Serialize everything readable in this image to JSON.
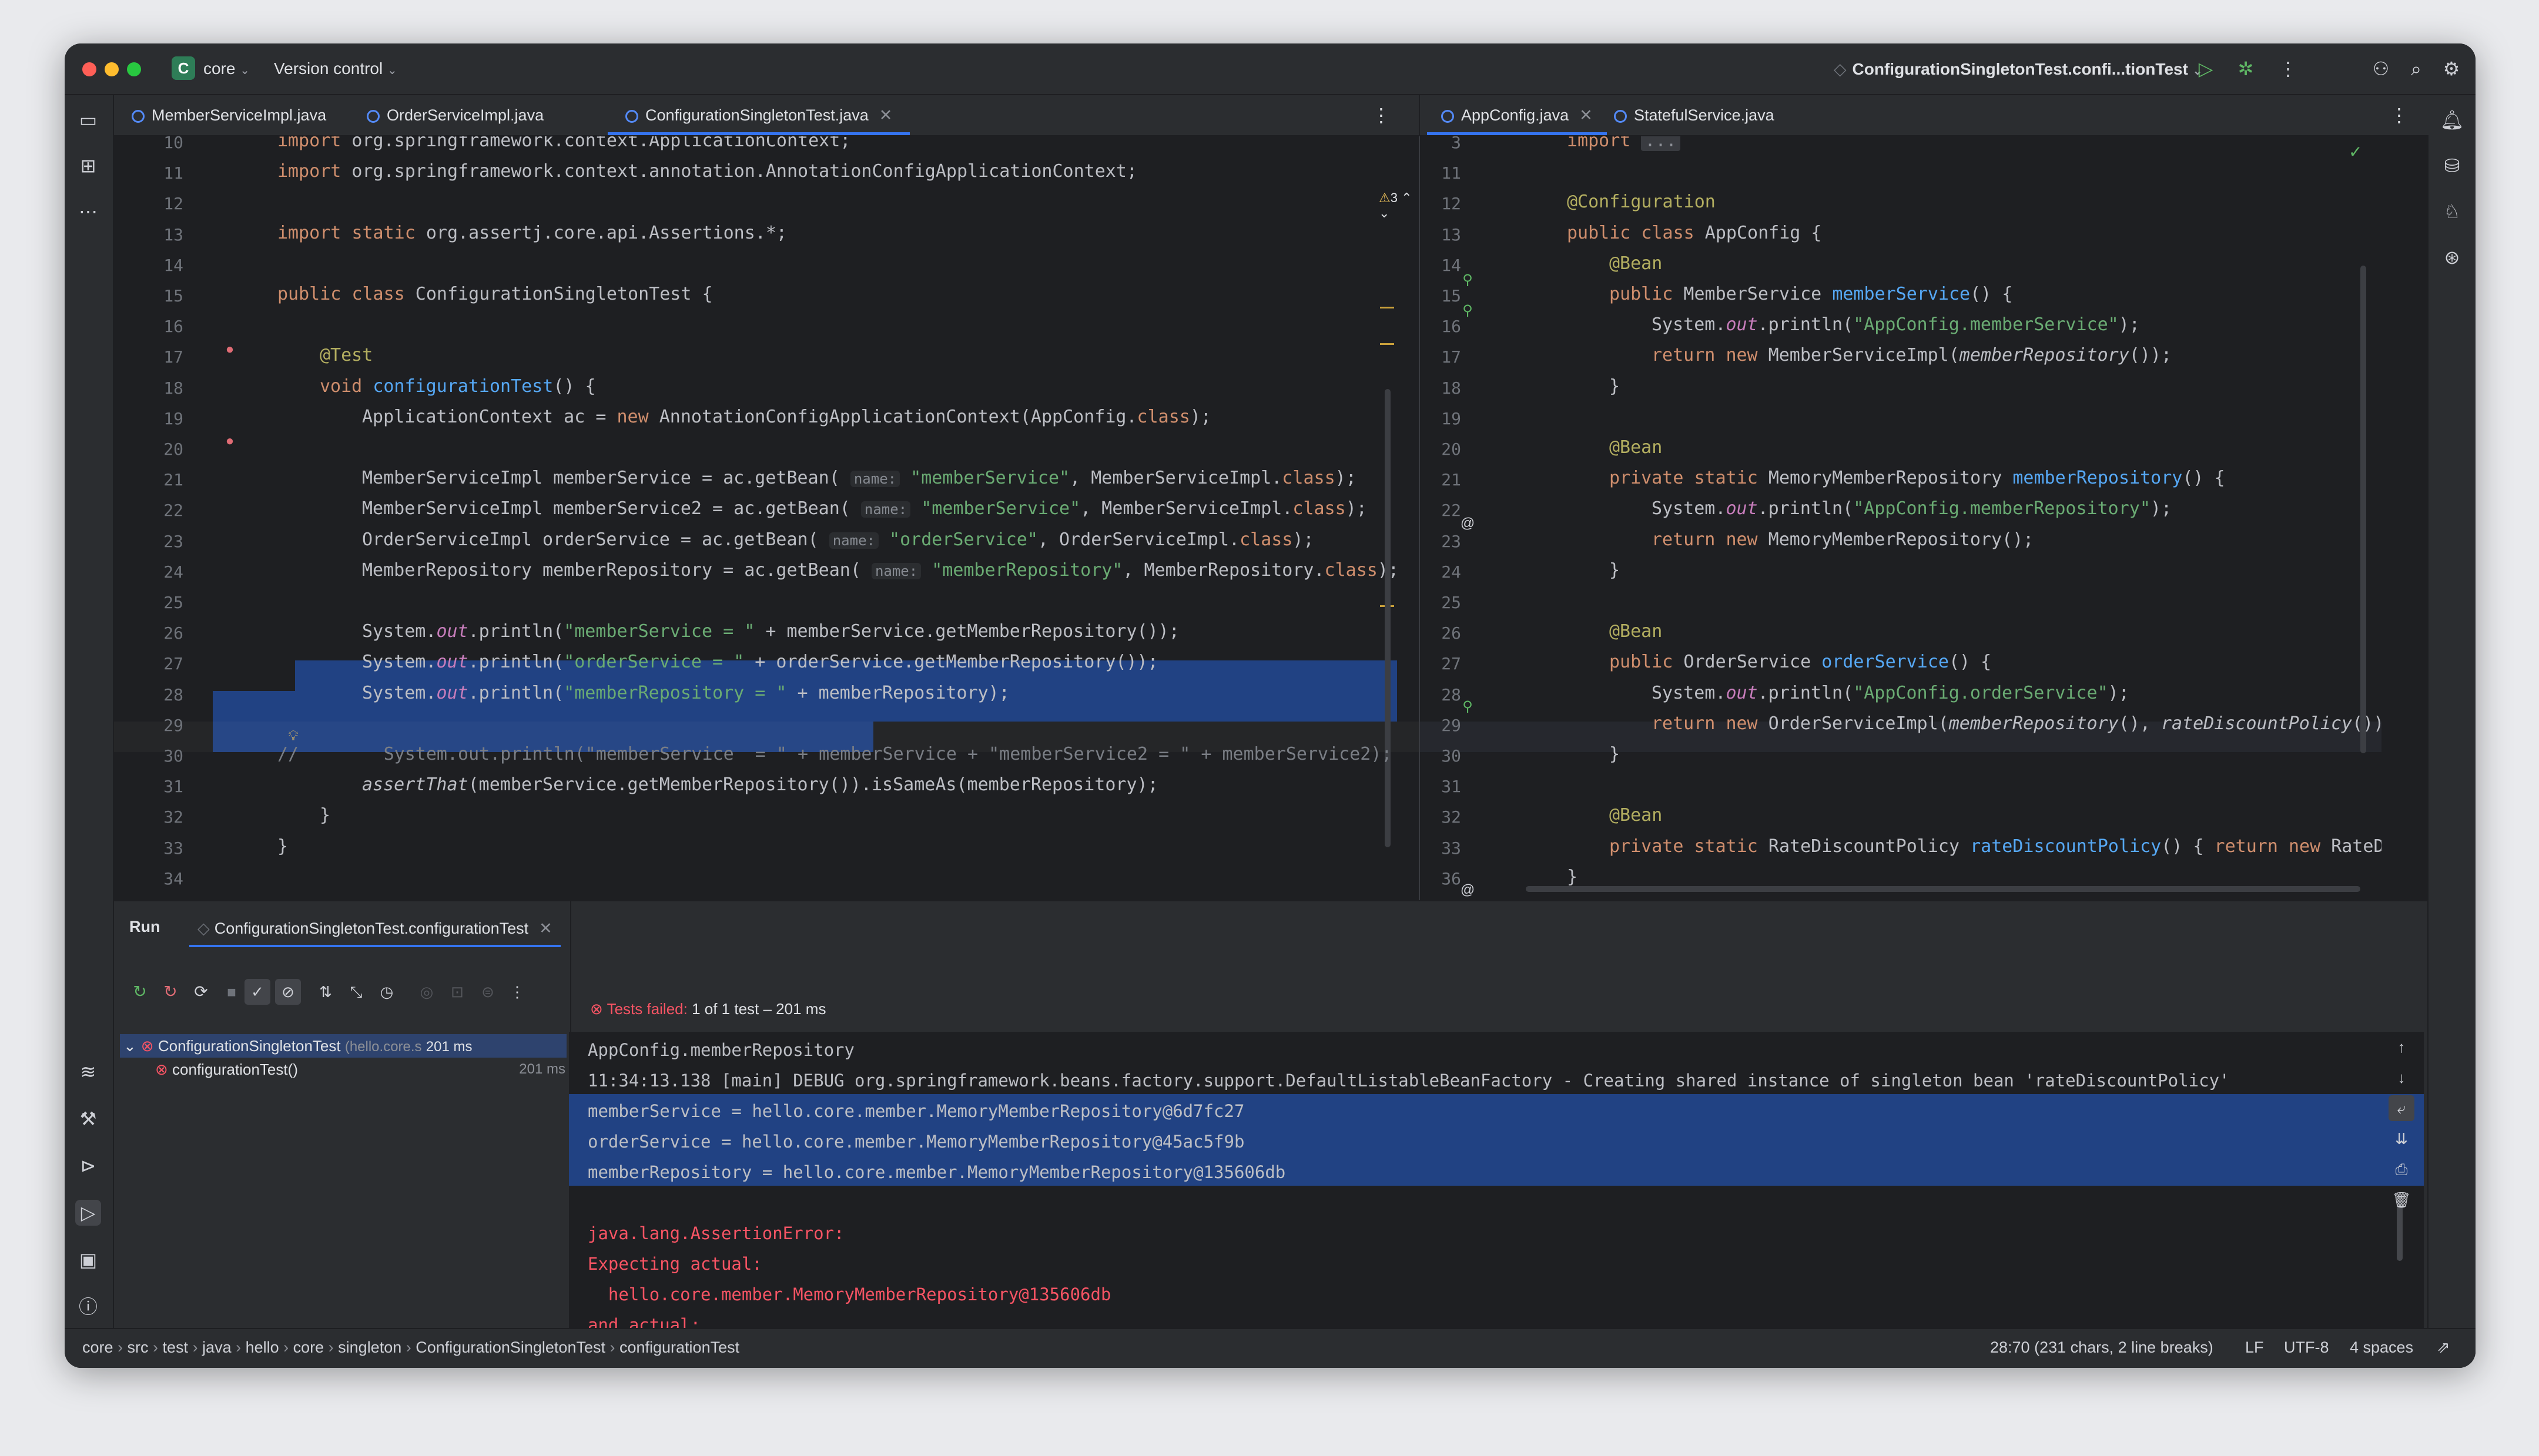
{
  "titlebar": {
    "project_letter": "C",
    "project_name": "core",
    "vcs_label": "Version control",
    "run_config": "ConfigurationSingletonTest.confi...tionTest"
  },
  "left_tabs": [
    {
      "label": "MemberServiceImpl.java"
    },
    {
      "label": "OrderServiceImpl.java"
    },
    {
      "label": "ConfigurationSingletonTest.java"
    }
  ],
  "right_tabs": [
    {
      "label": "AppConfig.java"
    },
    {
      "label": "StatefulService.java"
    }
  ],
  "left_editor": {
    "warnings": "3",
    "line_numbers": [
      "10",
      "11",
      "12",
      "13",
      "14",
      "15",
      "16",
      "17",
      "18",
      "19",
      "20",
      "21",
      "22",
      "23",
      "24",
      "25",
      "26",
      "27",
      "28",
      "29",
      "30",
      "31",
      "32",
      "33",
      "34"
    ],
    "lines": [
      "import org.springframework.context.ApplicationContext;",
      "import org.springframework.context.annotation.AnnotationConfigApplicationContext;",
      "",
      "import static org.assertj.core.api.Assertions.*;",
      "",
      "public class ConfigurationSingletonTest {",
      "",
      "@Test",
      "void configurationTest() {",
      "ApplicationContext ac = new AnnotationConfigApplicationContext(AppConfig.class);",
      "",
      "MemberServiceImpl memberService = ac.getBean( name: \"memberService\", MemberServiceImpl.class);",
      "MemberServiceImpl memberService2 = ac.getBean( name: \"memberService\", MemberServiceImpl.class);",
      "OrderServiceImpl orderService = ac.getBean( name: \"orderService\", OrderServiceImpl.class);",
      "MemberRepository memberRepository = ac.getBean( name: \"memberRepository\", MemberRepository.class);",
      "",
      "System.out.println(\"memberService = \" + memberService.getMemberRepository());",
      "System.out.println(\"orderService = \" + orderService.getMemberRepository());",
      "System.out.println(\"memberRepository = \" + memberRepository);",
      "",
      "//        System.out.println(\"memberService  = \" + memberService + \"memberService2 = \" + memberService2);",
      "assertThat(memberService.getMemberRepository()).isSameAs(memberRepository);",
      "}",
      "}",
      ""
    ]
  },
  "right_editor": {
    "line_numbers": [
      "3",
      "11",
      "12",
      "13",
      "14",
      "15",
      "16",
      "17",
      "18",
      "19",
      "20",
      "21",
      "22",
      "23",
      "24",
      "25",
      "26",
      "27",
      "28",
      "29",
      "30",
      "31",
      "32",
      "33",
      "36"
    ],
    "lines": [
      "import ...",
      "",
      "@Configuration",
      "public class AppConfig {",
      "@Bean",
      "public MemberService memberService() {",
      "System.out.println(\"AppConfig.memberService\");",
      "return new MemberServiceImpl(memberRepository());",
      "}",
      "",
      "@Bean",
      "private static MemoryMemberRepository memberRepository() {",
      "System.out.println(\"AppConfig.memberRepository\");",
      "return new MemoryMemberRepository();",
      "}",
      "",
      "@Bean",
      "public OrderService orderService() {",
      "System.out.println(\"AppConfig.orderService\");",
      "return new OrderServiceImpl(memberRepository(), rateDiscountPolicy());",
      "}",
      "",
      "@Bean",
      "private static RateDiscountPolicy rateDiscountPolicy() { return new RateDiscountPol",
      "}"
    ]
  },
  "run": {
    "title": "Run",
    "tab_label": "ConfigurationSingletonTest.configurationTest",
    "tree_root": "ConfigurationSingletonTest",
    "tree_root_pkg": "(hello.core.s",
    "tree_root_time": "201 ms",
    "tree_child": "configurationTest()",
    "tree_child_time": "201 ms",
    "status_prefix": "Tests failed:",
    "status_detail": "1 of 1 test – 201 ms",
    "console_lines": [
      "AppConfig.memberRepository",
      "11:34:13.138 [main] DEBUG org.springframework.beans.factory.support.DefaultListableBeanFactory - Creating shared instance of singleton bean 'rateDiscountPolicy'",
      "memberService = hello.core.member.MemoryMemberRepository@6d7fc27",
      "orderService = hello.core.member.MemoryMemberRepository@45ac5f9b",
      "memberRepository = hello.core.member.MemoryMemberRepository@135606db",
      "",
      "java.lang.AssertionError:",
      "Expecting actual:",
      "  hello.core.member.MemoryMemberRepository@135606db",
      "and actual:"
    ]
  },
  "statusbar": {
    "crumbs": [
      "core",
      "src",
      "test",
      "java",
      "hello",
      "core",
      "singleton",
      "ConfigurationSingletonTest",
      "configurationTest"
    ],
    "position": "28:70 (231 chars, 2 line breaks)",
    "line_sep": "LF",
    "encoding": "UTF-8",
    "indent": "4 spaces"
  },
  "colors": {
    "accent": "#3574f0",
    "selection": "#214283",
    "error": "#f75464",
    "keyword": "#cf8e6d",
    "string": "#6aab73"
  }
}
